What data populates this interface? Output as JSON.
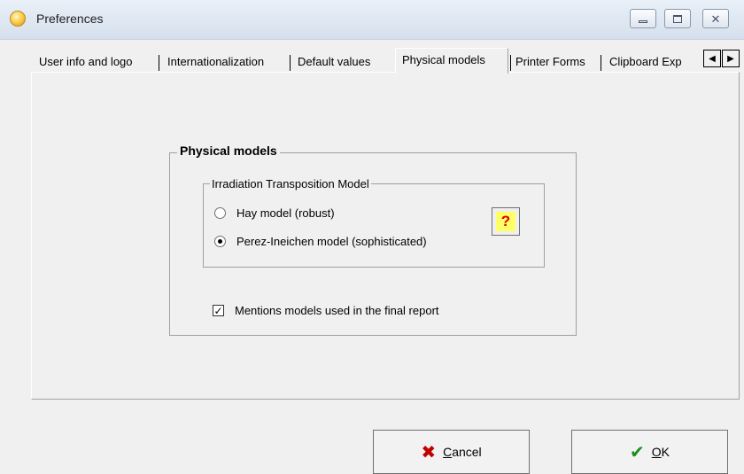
{
  "window": {
    "title": "Preferences",
    "buttons": {
      "minimize_icon": "minimize-icon",
      "maximize_icon": "maximize-icon",
      "close_icon": "close-icon"
    }
  },
  "tabs": [
    {
      "label": "User info and logo",
      "active": false
    },
    {
      "label": "Internationalization",
      "active": false
    },
    {
      "label": "Default values",
      "active": false
    },
    {
      "label": "Physical models",
      "active": true
    },
    {
      "label": "Printer Forms",
      "active": false
    },
    {
      "label": "Clipboard Exp",
      "active": false
    }
  ],
  "physical_models": {
    "group_title": "Physical models",
    "transposition": {
      "group_title": "Irradiation Transposition Model",
      "options": [
        {
          "label": "Hay model (robust)",
          "selected": false
        },
        {
          "label": "Perez-Ineichen model (sophisticated)",
          "selected": true
        }
      ],
      "help_label": "?"
    },
    "mention_models": {
      "label": "Mentions models used in the final report",
      "checked": true
    }
  },
  "footer": {
    "cancel": {
      "mnemonic": "C",
      "rest": "ancel"
    },
    "ok": {
      "mnemonic": "O",
      "rest": "K"
    }
  },
  "colors": {
    "help_bg": "#ffff66",
    "help_fg": "#e00000",
    "cancel_icon": "#c00000",
    "ok_icon": "#1a8f1a"
  }
}
